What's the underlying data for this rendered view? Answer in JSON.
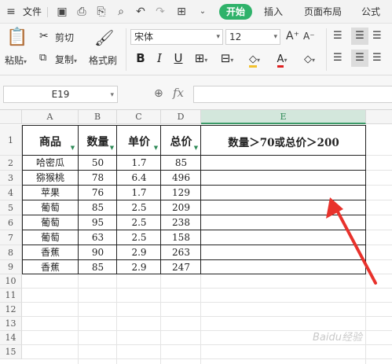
{
  "menubar": {
    "file_label": "文件",
    "tabs": [
      "开始",
      "插入",
      "页面布局",
      "公式"
    ],
    "active_tab": "开始",
    "accent": "#2fb26a"
  },
  "ribbon": {
    "paste_label": "粘贴",
    "cut_label": "剪切",
    "copy_label": "复制",
    "format_painter_label": "格式刷",
    "font_name": "宋体",
    "font_size": "12",
    "font_color": "#e02020",
    "fill_color": "#f2c12e"
  },
  "formula_bar": {
    "cell_ref": "E19",
    "fx_label": "fx",
    "value": ""
  },
  "sheet": {
    "columns": [
      "A",
      "B",
      "C",
      "D",
      "E"
    ],
    "selected_column": "E",
    "rows": [
      "1",
      "2",
      "3",
      "4",
      "5",
      "6",
      "7",
      "8",
      "9",
      "10",
      "11",
      "12",
      "13",
      "14",
      "15"
    ],
    "headers": [
      "商品",
      "数量",
      "单价",
      "总价",
      "数量＞70或总价＞200"
    ],
    "data": [
      [
        "哈密瓜",
        "50",
        "1.7",
        "85"
      ],
      [
        "猕猴桃",
        "78",
        "6.4",
        "496"
      ],
      [
        "苹果",
        "76",
        "1.7",
        "129"
      ],
      [
        "葡萄",
        "85",
        "2.5",
        "209"
      ],
      [
        "葡萄",
        "95",
        "2.5",
        "238"
      ],
      [
        "葡萄",
        "63",
        "2.5",
        "158"
      ],
      [
        "香蕉",
        "90",
        "2.9",
        "263"
      ],
      [
        "香蕉",
        "85",
        "2.9",
        "247"
      ]
    ]
  },
  "annotation": {
    "arrow_color": "#e8322c"
  },
  "watermark": "Baidu经验"
}
